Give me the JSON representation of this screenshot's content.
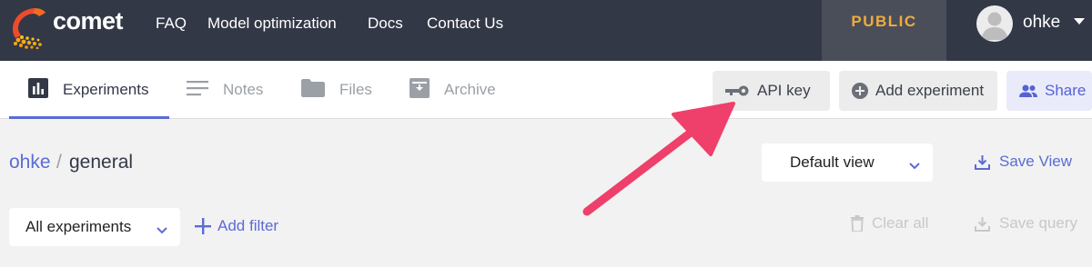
{
  "brand": {
    "name": "comet"
  },
  "nav": {
    "links": [
      "FAQ",
      "Model optimization",
      "Docs",
      "Contact Us"
    ],
    "visibility_badge": "PUBLIC",
    "username": "ohke"
  },
  "tabs": [
    {
      "label": "Experiments",
      "icon": "bar-chart-icon",
      "active": true
    },
    {
      "label": "Notes",
      "icon": "notes-icon",
      "active": false
    },
    {
      "label": "Files",
      "icon": "folder-icon",
      "active": false
    },
    {
      "label": "Archive",
      "icon": "archive-icon",
      "active": false
    }
  ],
  "actions": {
    "api_key": "API key",
    "add_experiment": "Add experiment",
    "share": "Share"
  },
  "breadcrumb": {
    "workspace": "ohke",
    "separator": "/",
    "project": "general"
  },
  "view": {
    "selected": "Default view",
    "save_label": "Save View"
  },
  "filters": {
    "experiments_select": "All experiments",
    "add_filter": "Add filter",
    "clear_all": "Clear all",
    "save_query": "Save query"
  },
  "colors": {
    "navbar": "#333847",
    "accent": "#5b6bd6",
    "public_badge": "#f1ac3d",
    "annotation_arrow": "#ef3f6b"
  }
}
